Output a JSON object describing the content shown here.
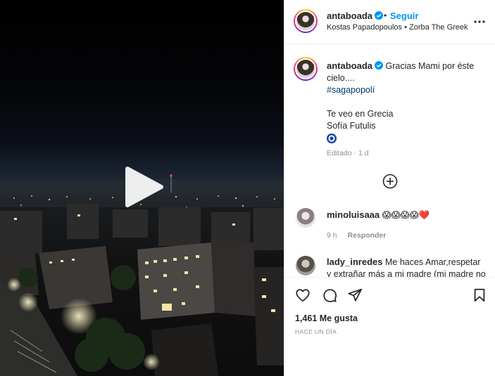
{
  "post": {
    "username": "antaboada",
    "verified": true,
    "dot": "•",
    "follow_label": "Seguir",
    "audio": "Kostas Papadopoulos • Zorba The Greek",
    "more_icon": "more-horizontal-icon"
  },
  "caption": {
    "username": "antaboada",
    "line1": "Gracias Mami por éste cielo....",
    "hashtag": "#sagapopolí",
    "line2": "Te veo en Grecia",
    "line3": "Sofía Futulis",
    "emoji_icon": "nazar-evil-eye-icon",
    "edited": "Editado · 1 d"
  },
  "load_more_icon": "plus-circle-icon",
  "comments": [
    {
      "username": "minoluisaaa",
      "text": "😱😱😱😱❤️",
      "time": "9 h",
      "reply_label": "Responder"
    },
    {
      "username": "lady_inredes",
      "text": "Me haces Amar,respetar y extrañar más a mi madre (mi madre no"
    }
  ],
  "actions": {
    "like_icon": "heart-icon",
    "comment_icon": "comment-icon",
    "share_icon": "share-icon",
    "save_icon": "bookmark-icon"
  },
  "likes": "1,461 Me gusta",
  "posted": "HACE UN DÍA",
  "video": {
    "play_icon": "play-icon"
  },
  "colors": {
    "accent": "#0095f6",
    "hashtag": "#00376b",
    "muted": "#8e8e8e",
    "heart_red": "#ed4956"
  }
}
